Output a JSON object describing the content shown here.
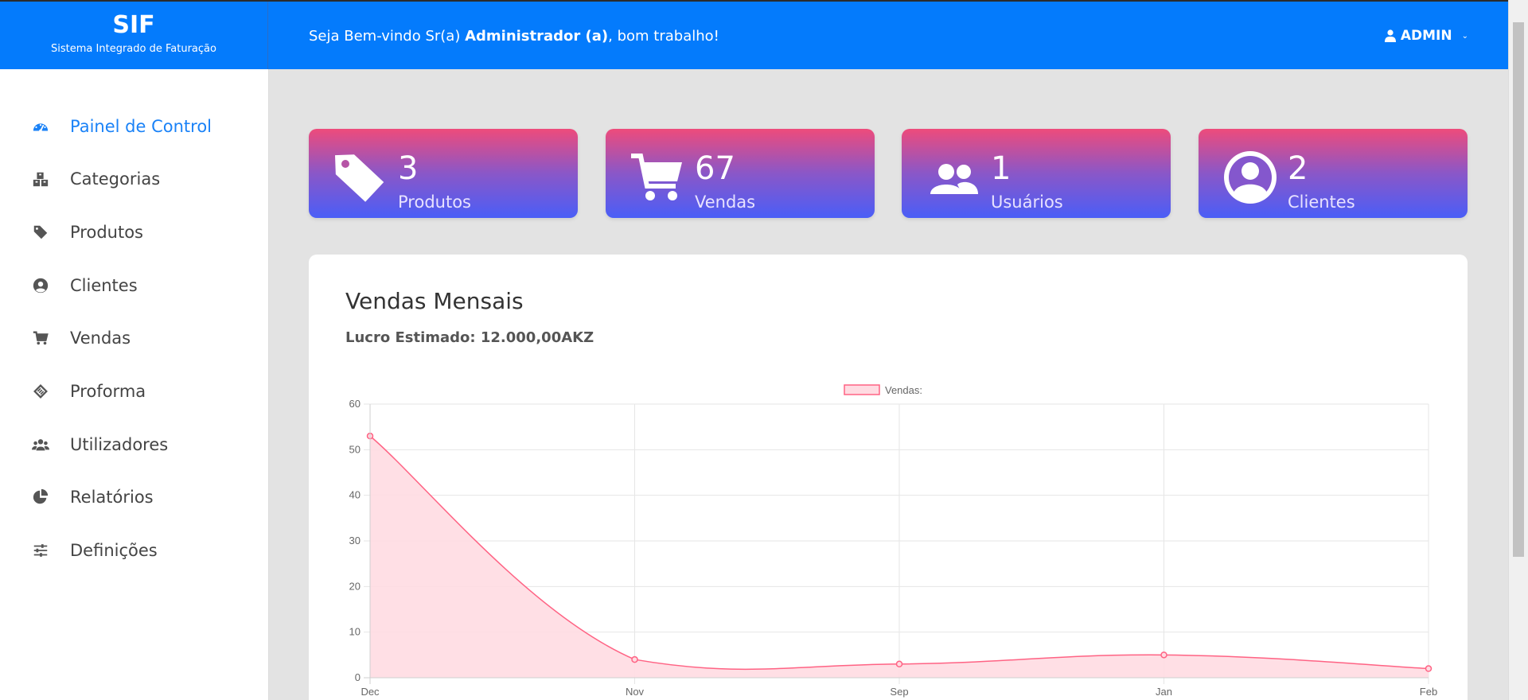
{
  "header": {
    "brand_title": "SIF",
    "brand_subtitle": "Sistema Integrado de Faturação",
    "welcome_prefix": "Seja Bem-vindo Sr(a) ",
    "welcome_user": "Administrador (a)",
    "welcome_suffix": ", bom trabalho!",
    "user_label": "ADMIN"
  },
  "sidebar": {
    "items": [
      {
        "label": "Painel de Control",
        "icon": "dashboard-icon",
        "active": true
      },
      {
        "label": "Categorias",
        "icon": "boxes-icon"
      },
      {
        "label": "Produtos",
        "icon": "tag-icon"
      },
      {
        "label": "Clientes",
        "icon": "user-circle-icon"
      },
      {
        "label": "Vendas",
        "icon": "cart-icon"
      },
      {
        "label": "Proforma",
        "icon": "receipt-icon"
      },
      {
        "label": "Utilizadores",
        "icon": "users-icon"
      },
      {
        "label": "Relatórios",
        "icon": "pie-chart-icon"
      },
      {
        "label": "Definições",
        "icon": "sliders-icon"
      }
    ]
  },
  "cards": [
    {
      "value": "3",
      "label": "Produtos",
      "icon": "tag-icon"
    },
    {
      "value": "67",
      "label": "Vendas",
      "icon": "cart-icon"
    },
    {
      "value": "1",
      "label": "Usuários",
      "icon": "users-icon"
    },
    {
      "value": "2",
      "label": "Clientes",
      "icon": "user-circle-icon"
    }
  ],
  "panel": {
    "title": "Vendas Mensais",
    "subtitle": "Lucro Estimado: 12.000,00AKZ"
  },
  "chart_data": {
    "type": "area",
    "categories": [
      "Dec",
      "Nov",
      "Sep",
      "Jan",
      "Feb"
    ],
    "series": [
      {
        "name": "Vendas:",
        "values": [
          53,
          4,
          3,
          5,
          2
        ]
      }
    ],
    "ylim": [
      0,
      60
    ],
    "yticks": [
      0,
      10,
      20,
      30,
      40,
      50,
      60
    ],
    "grid": true,
    "legend": "top-center",
    "colors": {
      "line": "#ff6384",
      "fill": "#ffdbe2"
    }
  }
}
